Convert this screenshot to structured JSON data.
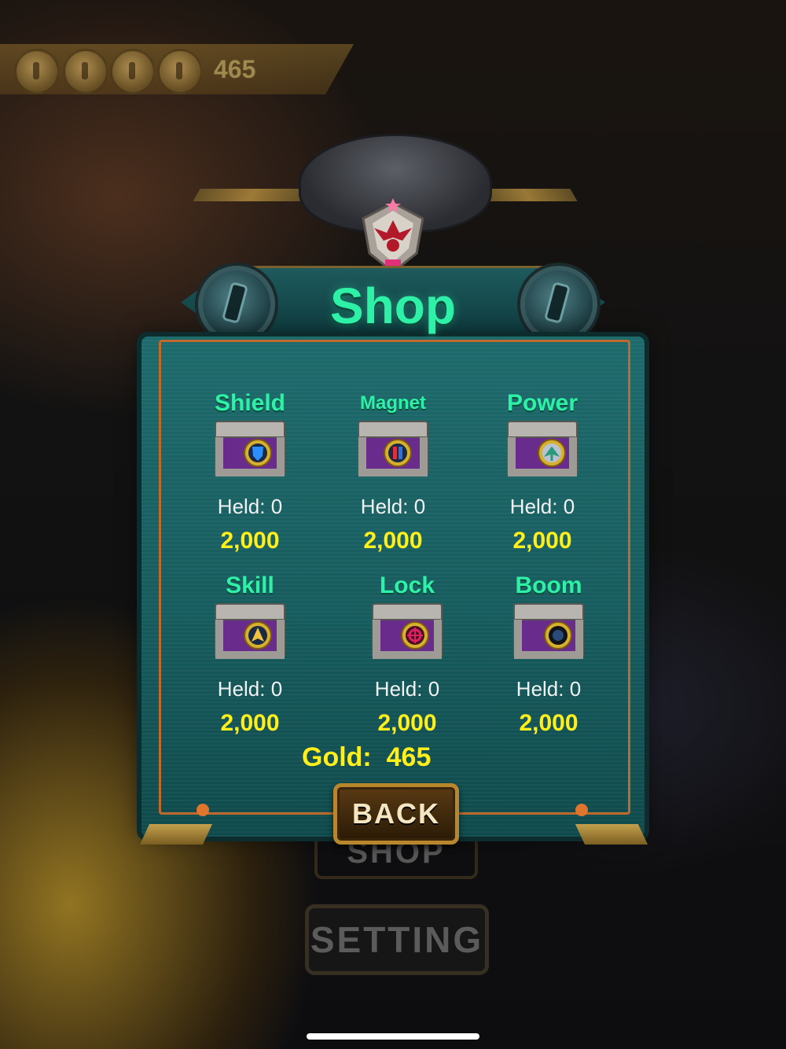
{
  "hud": {
    "gold": "465"
  },
  "shop": {
    "title": "Shop",
    "items": [
      {
        "name": "Shield",
        "held_label": "Held: 0",
        "price": "2,000",
        "icon": "shield-chest-icon"
      },
      {
        "name": "Magnet",
        "held_label": "Held: 0",
        "price": "2,000",
        "icon": "magnet-chest-icon"
      },
      {
        "name": "Power",
        "held_label": "Held: 0",
        "price": "2,000",
        "icon": "power-chest-icon"
      },
      {
        "name": "Skill",
        "held_label": "Held: 0",
        "price": "2,000",
        "icon": "skill-chest-icon"
      },
      {
        "name": "Lock",
        "held_label": "Held: 0",
        "price": "2,000",
        "icon": "lock-chest-icon"
      },
      {
        "name": "Boom",
        "held_label": "Held: 0",
        "price": "2,000",
        "icon": "boom-chest-icon"
      }
    ],
    "gold_label": "Gold:  465",
    "back_label": "BACK"
  },
  "background_menu": {
    "shop_label": "SHOP",
    "setting_label": "SETTING"
  },
  "colors": {
    "title_green": "#2ef1a8",
    "price_yellow": "#ffef1a",
    "panel_teal": "#1d6a6c",
    "frame_orange": "#c0692d"
  }
}
